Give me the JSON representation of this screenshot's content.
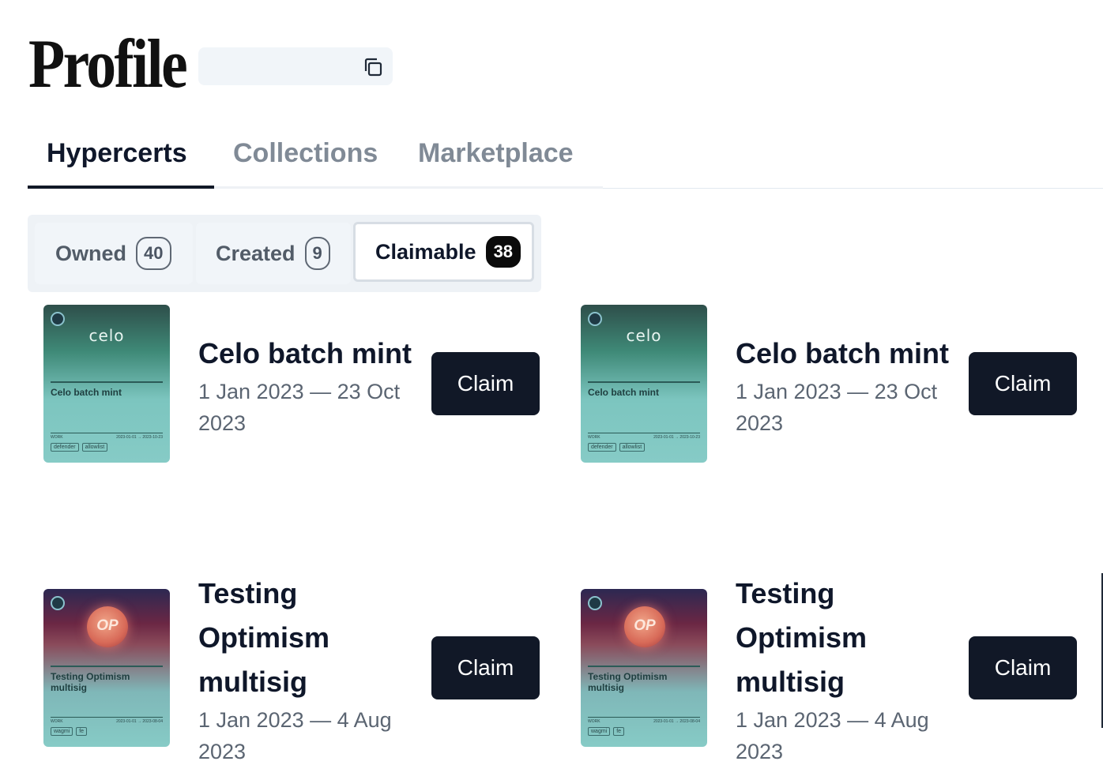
{
  "header": {
    "title": "Profile",
    "address": ""
  },
  "tabs": [
    {
      "label": "Hypercerts",
      "active": true
    },
    {
      "label": "Collections",
      "active": false
    },
    {
      "label": "Marketplace",
      "active": false
    }
  ],
  "subtabs": [
    {
      "label": "Owned",
      "count": "40"
    },
    {
      "label": "Created",
      "count": "9"
    },
    {
      "label": "Claimable",
      "count": "38",
      "active": true
    }
  ],
  "cards": [
    {
      "title": "Celo batch mint",
      "date": "1 Jan 2023 — 23 Oct 2023",
      "button": "Claim",
      "thumb": {
        "brand": "celo",
        "title": "Celo batch mint",
        "work": "WORK",
        "range": "2023-01-01 → 2023-10-23",
        "tags": [
          "defender",
          "allowlist"
        ]
      }
    },
    {
      "title": "Celo batch mint",
      "date": "1 Jan 2023 — 23 Oct 2023",
      "button": "Claim",
      "thumb": {
        "brand": "celo",
        "title": "Celo batch mint",
        "work": "WORK",
        "range": "2023-01-01 → 2023-10-23",
        "tags": [
          "defender",
          "allowlist"
        ]
      }
    },
    {
      "title": "Testing Optimism multisig",
      "date": "1 Jan 2023 — 4 Aug 2023",
      "button": "Claim",
      "thumb": {
        "brand": "OP",
        "title": "Testing Optimism multisig",
        "work": "WORK",
        "range": "2023-01-01 → 2023-08-04",
        "tags": [
          "wagmi",
          "fe"
        ]
      }
    },
    {
      "title": "Testing Optimism multisig",
      "date": "1 Jan 2023 — 4 Aug 2023",
      "button": "Claim",
      "thumb": {
        "brand": "OP",
        "title": "Testing Optimism multisig",
        "work": "WORK",
        "range": "2023-01-01 → 2023-08-04",
        "tags": [
          "wagmi",
          "fe"
        ]
      }
    }
  ],
  "colors": {
    "primary_button": "#111827",
    "active_text": "#0f172a",
    "inactive_text": "#808a96",
    "card_teal": "#86cbc6"
  }
}
